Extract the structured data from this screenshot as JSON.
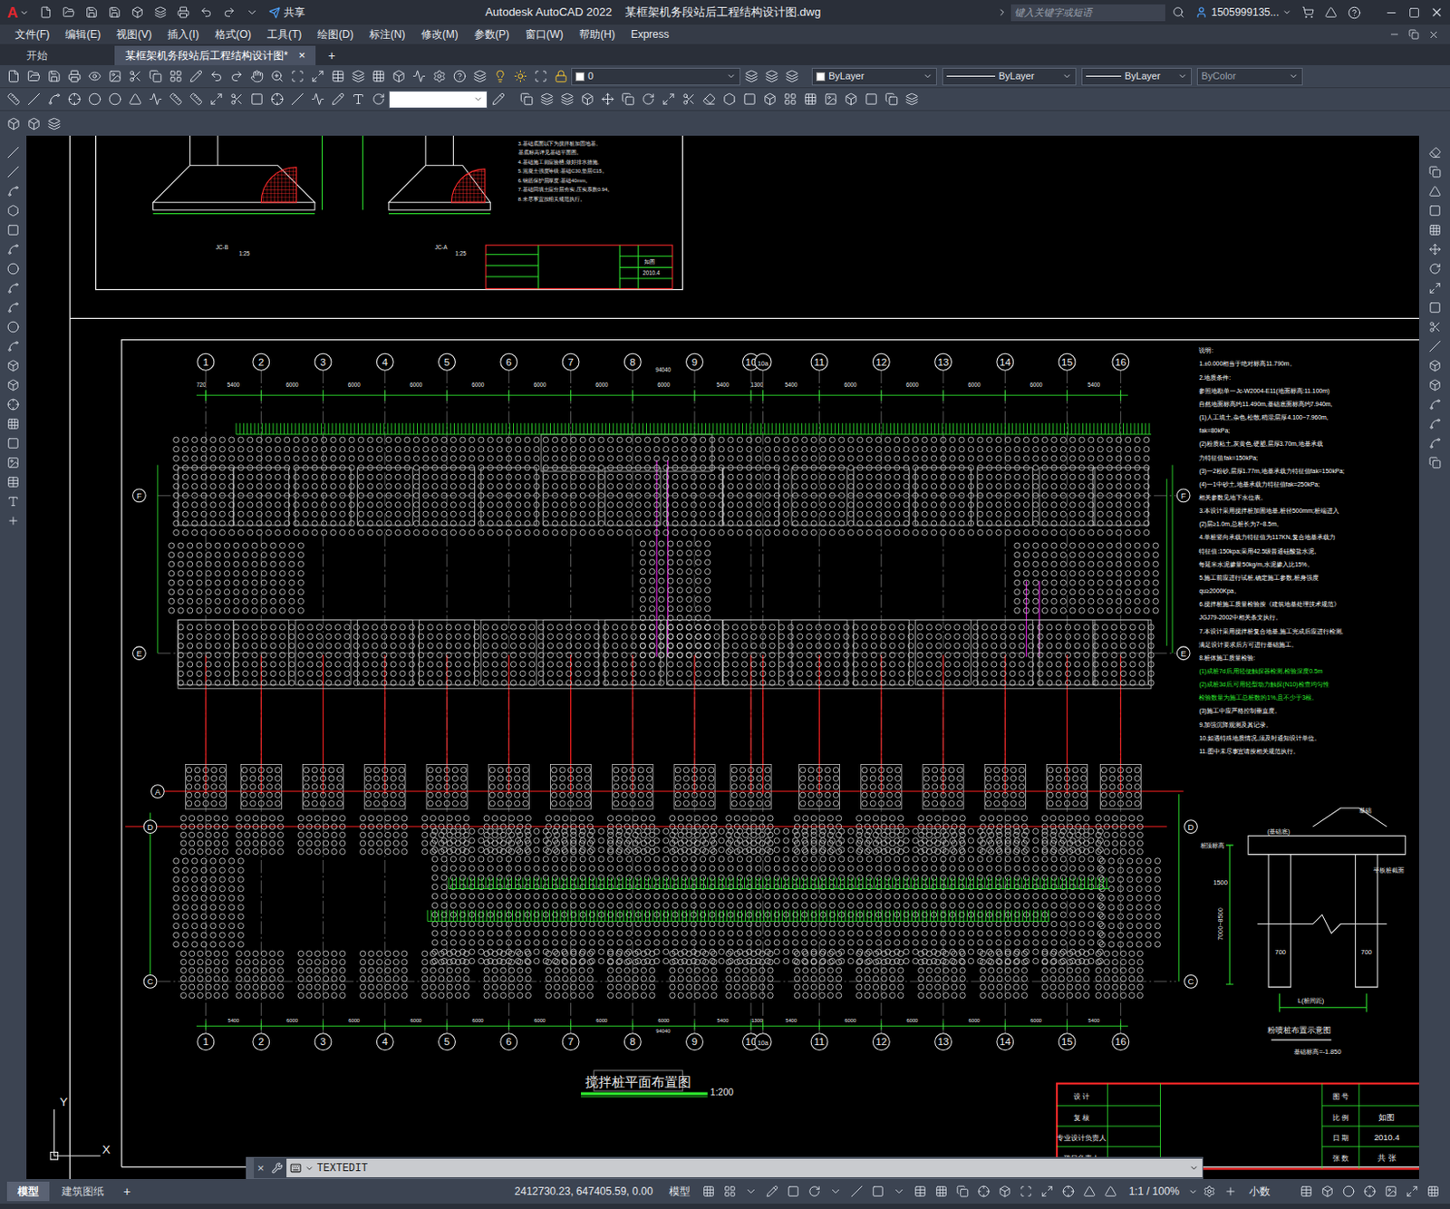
{
  "app_logo": "A",
  "window": {
    "title": "Autodesk AutoCAD 2022    某框架机务段站后工程结构设计图.dwg"
  },
  "share": "共享",
  "search": {
    "placeholder": "键入关键字或短语"
  },
  "user": "1505999135...",
  "menu": [
    "文件(F)",
    "编辑(E)",
    "视图(V)",
    "插入(I)",
    "格式(O)",
    "工具(T)",
    "绘图(D)",
    "标注(N)",
    "修改(M)",
    "参数(P)",
    "窗口(W)",
    "帮助(H)",
    "Express"
  ],
  "file_tabs": [
    {
      "label": "开始",
      "selected": false,
      "closable": false
    },
    {
      "label": "某框架机务段站后工程结构设计图*",
      "selected": true,
      "closable": true
    }
  ],
  "tab_close": "×",
  "tab_add": "+",
  "properties": {
    "layer": "0",
    "color": "ByLayer",
    "linetype": "ByLayer",
    "lineweight": "ByLayer",
    "plot_style": "ByColor"
  },
  "drawing": {
    "top_sheet": {
      "labels": [
        "JC-B",
        "1:25",
        "JC-A",
        "1:25"
      ],
      "notes": [
        "3.基础底面以下为搅拌桩加固地基,",
        "  基底标高详见基础平面图。",
        "4.基础施工前应验槽,做好排水措施,",
        "5.混凝土强度等级:基础C30,垫层C15。",
        "6.钢筋保护层厚度:基础40mm。",
        "7.基础回填土应分层夯实,压实系数0.94。",
        "8.未尽事宜按相关规范执行。"
      ],
      "title_block": [
        "如图",
        "2010.4"
      ]
    },
    "axes_columns": [
      "1",
      "2",
      "3",
      "4",
      "5",
      "6",
      "7",
      "8",
      "9",
      "10",
      "10a",
      "11",
      "12",
      "13",
      "14",
      "15",
      "16"
    ],
    "axes_rows_left": [
      "F",
      "E",
      "A",
      "D",
      "C"
    ],
    "axes_rows_right": [
      "F",
      "E",
      "D",
      "C"
    ],
    "dims_start": "720",
    "dims": [
      "5400",
      "6000",
      "6000",
      "6000",
      "6000",
      "6000",
      "6000",
      "6000",
      "5400",
      "1300",
      "5400",
      "6000",
      "6000",
      "6000",
      "6000",
      "5400"
    ],
    "dim_total": "94040",
    "notes": [
      {
        "text": "说明:",
        "color": "#ffffff"
      },
      {
        "text": "1.±0.000相当于绝对标高11.790m。",
        "color": "#ffffff"
      },
      {
        "text": "2.地质条件:",
        "color": "#ffffff"
      },
      {
        "text": "  参照地勘单一Jc-W2004-E11(地面标高:11.100m)",
        "color": "#ffffff"
      },
      {
        "text": "  自然地面标高约11.490m,基础底面标高约7.940m,",
        "color": "#ffffff"
      },
      {
        "text": "  (1)人工填土,杂色,松散,稍湿;层厚4.100~7.960m,",
        "color": "#ffffff"
      },
      {
        "text": "   fak=80kPa;",
        "color": "#ffffff"
      },
      {
        "text": "  (2)粉质粘土,灰黄色,硬塑,层厚3.70m,地基承载",
        "color": "#ffffff"
      },
      {
        "text": "   力特征值fak=150kPa;",
        "color": "#ffffff"
      },
      {
        "text": "  (3)一2粉砂,层厚1.77m,地基承载力特征值fak=150kPa;",
        "color": "#ffffff"
      },
      {
        "text": "  (4)一1中砂土,地基承载力特征值fak=250kPa;",
        "color": "#ffffff"
      },
      {
        "text": "  相关参数见地下水位表。",
        "color": "#ffffff"
      },
      {
        "text": "3.本设计采用搅拌桩加固地基,桩径500mm;桩端进入",
        "color": "#ffffff"
      },
      {
        "text": "  (2)层≥1.0m,总桩长为7~8.5m。",
        "color": "#ffffff"
      },
      {
        "text": "4.单桩竖向承载力特征值为117KN,复合地基承载力",
        "color": "#ffffff"
      },
      {
        "text": "  特征值:150kpa;采用42.5级普通硅酸盐水泥,",
        "color": "#ffffff"
      },
      {
        "text": "  每延米水泥掺量50kg/m,水泥掺入比15%。",
        "color": "#ffffff"
      },
      {
        "text": "5.施工前应进行试桩,确定施工参数,桩身强度",
        "color": "#ffffff"
      },
      {
        "text": "  qu≥2000Kpa。",
        "color": "#ffffff"
      },
      {
        "text": "6.搅拌桩施工质量检验按《建筑地基处理技术规范》",
        "color": "#ffffff"
      },
      {
        "text": "  JGJ79-2002中相关条文执行。",
        "color": "#ffffff"
      },
      {
        "text": "7.本设计采用搅拌桩复合地基,施工完成后应进行检测,",
        "color": "#ffffff"
      },
      {
        "text": "  满足设计要求后方可进行基础施工。",
        "color": "#ffffff"
      },
      {
        "text": "8.桩体施工质量检验:",
        "color": "#ffffff"
      },
      {
        "text": "(1)成桩7d后,用轻便触探器检测,检验深度0.5m",
        "color": "#2ee82e"
      },
      {
        "text": "(2)成桩3d后,可用轻型动力触探(N10)检查均匀性",
        "color": "#2ee82e"
      },
      {
        "text": "  检验数量为施工总桩数的1%,且不少于3根。",
        "color": "#2ee82e"
      },
      {
        "text": "(3)施工中应严格控制垂直度。",
        "color": "#ffffff"
      },
      {
        "text": "9.加强沉降观测及其记录。",
        "color": "#ffffff"
      },
      {
        "text": "10.如遇特殊地质情况,须及时通知设计单位。",
        "color": "#ffffff"
      },
      {
        "text": "11.图中未尽事宜请按相关规范执行。",
        "color": "#ffffff"
      }
    ],
    "detail": {
      "title": "粉喷桩布置示意图",
      "labels": [
        "基础",
        "(基础底)",
        "桩顶标高",
        "1500",
        "7000~8500",
        "700",
        "700",
        "L(桩间距)",
        "基础标高=-1.850",
        "平板桩截面"
      ]
    },
    "plan_title": "搅拌桩平面布置图",
    "plan_scale": "1:200",
    "title_block": {
      "rows": [
        {
          "left": "设 计",
          "right_label": "图 号",
          "right_value": ""
        },
        {
          "left": "复 核",
          "right_label": "比 例",
          "right_value": "如图"
        },
        {
          "left": "专业设计负责人",
          "right_label": "日 期",
          "right_value": "2010.4"
        },
        {
          "left": "项目负责人",
          "right_label": "张 数",
          "right_value": "共 张"
        }
      ]
    },
    "ucs": {
      "x": "X",
      "y": "Y"
    }
  },
  "command_line": {
    "close": "×",
    "command": "TEXTEDIT"
  },
  "layout_tabs": [
    {
      "label": "模型",
      "selected": true
    },
    {
      "label": "建筑图纸",
      "selected": false
    }
  ],
  "layout_add": "+",
  "status": {
    "coords": "2412730.23, 647405.59, 0.00",
    "space": "模型",
    "scale": "1:1 / 100%",
    "units": "小数"
  }
}
